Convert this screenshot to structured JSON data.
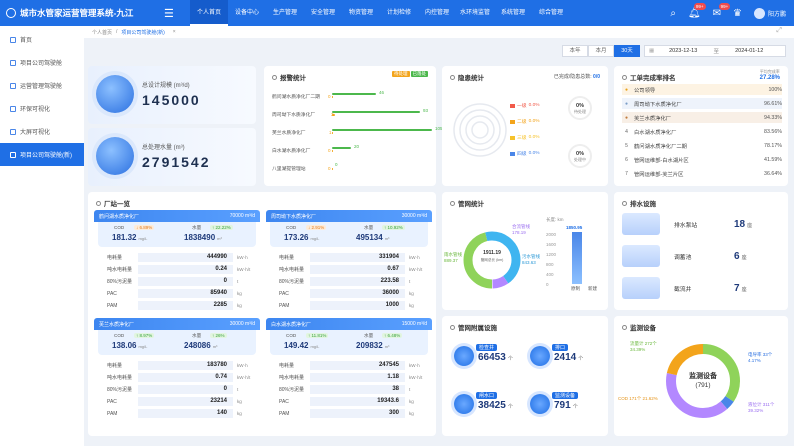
{
  "header": {
    "title": "城市水管家运营管理系统-九江",
    "nav": [
      "个人首页",
      "设备中心",
      "生产管理",
      "安全管理",
      "物资管理",
      "计划检修",
      "内控管理",
      "水环境监管",
      "系统管理",
      "综合管理"
    ],
    "badge1": "99+",
    "badge2": "99+",
    "user": "阳方鹏"
  },
  "sidebar": {
    "items": [
      "首页",
      "项目公司驾驶舱",
      "运营管理驾驶舱",
      "环保可视化",
      "大屏可视化",
      "项目公司驾驶舱(新)"
    ]
  },
  "breadcrumb": {
    "home": "个人首页",
    "sep": "/",
    "current": "项目公司驾驶舱(新)",
    "close": "×"
  },
  "filter": {
    "tabs": [
      "本年",
      "本月",
      "30天"
    ],
    "start": "2023-12-13",
    "to": "至",
    "end": "2024-01-12"
  },
  "kpi": [
    {
      "label": "总设计规模 (m³/d)",
      "value": "145000"
    },
    {
      "label": "总处理水量 (m³)",
      "value": "2791542"
    }
  ],
  "alarm": {
    "title": "报警统计",
    "tag1": "待处理",
    "tag2": "已落处",
    "rows": [
      {
        "name": "鹤问湖水质净化厂二期",
        "v1": "46",
        "v2": "0",
        "p1": 0.44,
        "p2": 0
      },
      {
        "name": "周司坳下水质净化厂",
        "v1": "93",
        "v2": "3",
        "p1": 0.88,
        "p2": 0.03
      },
      {
        "name": "芙兰水质净化厂",
        "v1": "105",
        "v2": "1",
        "p1": 1.0,
        "p2": 0.01
      },
      {
        "name": "白水湖水质净化厂",
        "v1": "20",
        "v2": "0",
        "p1": 0.19,
        "p2": 0
      },
      {
        "name": "八里湖提管理站",
        "v1": "0",
        "v2": "0",
        "p1": 0,
        "p2": 0
      }
    ]
  },
  "hazard": {
    "title": "隐患统计",
    "summary_label": "已完成/隐患总数:",
    "summary_value": "0/0",
    "levels": [
      {
        "name": "一级",
        "pct": "0.0%"
      },
      {
        "name": "二级",
        "pct": "0.0%"
      },
      {
        "name": "三级",
        "pct": "0.0%"
      },
      {
        "name": "四级",
        "pct": "0.0%"
      }
    ],
    "d1_pct": "0%",
    "d1_label": "待处理",
    "d2_pct": "0%",
    "d2_label": "处理中"
  },
  "ranking": {
    "title": "工单完成率排名",
    "avg_label": "平均完成率",
    "avg_value": "27.28%",
    "rows": [
      {
        "n": "",
        "name": "公司领导",
        "pct": "100%"
      },
      {
        "n": "",
        "name": "周司坳下水质净化厂",
        "pct": "96.61%"
      },
      {
        "n": "",
        "name": "芙兰水质净化厂",
        "pct": "94.33%"
      },
      {
        "n": "4",
        "name": "白水湖水质净化厂",
        "pct": "83.56%"
      },
      {
        "n": "5",
        "name": "鹤问湖水质净化厂二期",
        "pct": "78.17%"
      },
      {
        "n": "6",
        "name": "管网运维部-白水湖片区",
        "pct": "41.59%"
      },
      {
        "n": "7",
        "name": "管网运维部-芙兰片区",
        "pct": "36.64%"
      }
    ]
  },
  "plants": {
    "title": "厂站一览",
    "row_labels": [
      "电耗量",
      "吨水电耗量",
      "80%污泥量",
      "PAC",
      "PAM"
    ],
    "row_units": [
      "kW·h",
      "kW·h/t",
      "t",
      "kg",
      "kg"
    ],
    "items": [
      {
        "name": "鹤问湖水质净化厂",
        "cap": "70000 m³/d",
        "cod_label": "COD",
        "cod": "181.32",
        "cod_unit": "mg/L",
        "cod_tag": "↓ 6.89%",
        "water_label": "水量",
        "water": "1838490",
        "water_unit": "m³",
        "water_tag": "↑ 22.22%",
        "rows": [
          "444990",
          "0.24",
          "0",
          "85940",
          "2285"
        ]
      },
      {
        "name": "周司坳下水质净化厂",
        "cap": "30000 m³/d",
        "cod_label": "COD",
        "cod": "173.26",
        "cod_unit": "mg/L",
        "cod_tag": "↓ 2.91%",
        "water_label": "水量",
        "water": "495134",
        "water_unit": "m³",
        "water_tag": "↑ 10.92%",
        "rows": [
          "331904",
          "0.67",
          "223.58",
          "36000",
          "1000"
        ]
      },
      {
        "name": "芙兰水质净化厂",
        "cap": "30000 m³/d",
        "cod_label": "COD",
        "cod": "138.06",
        "cod_unit": "mg/L",
        "cod_tag": "↑ 8.97%",
        "water_label": "水量",
        "water": "248086",
        "water_unit": "m³",
        "water_tag": "↑ 26%",
        "rows": [
          "183780",
          "0.74",
          "0",
          "23214",
          "140"
        ]
      },
      {
        "name": "白水湖水质净化厂",
        "cap": "15000 m³/d",
        "cod_label": "COD",
        "cod": "149.42",
        "cod_unit": "mg/L",
        "cod_tag": "↑ 11.81%",
        "water_label": "水量",
        "water": "209832",
        "water_unit": "m³",
        "water_tag": "↑ 6.48%",
        "rows": [
          "247545",
          "1.18",
          "38",
          "19343.6",
          "300"
        ]
      }
    ]
  },
  "pipe": {
    "title": "管网统计",
    "center_value": "1911.19",
    "center_label": "管网总长 (km)",
    "left_label": "雨水管线 889.37",
    "right_label": "污水管线 843.63",
    "top_label": "合流管线 178.19",
    "unit": "长度: km",
    "bar_value": "1850.95",
    "bar_names": [
      "原制",
      "新建"
    ],
    "axis": [
      "2000",
      "1600",
      "1200",
      "800",
      "400",
      "0"
    ]
  },
  "drain": {
    "title": "排水设施",
    "items": [
      {
        "name": "排水泵站",
        "value": "18",
        "unit": "座"
      },
      {
        "name": "调蓄池",
        "value": "6",
        "unit": "座"
      },
      {
        "name": "截流井",
        "value": "7",
        "unit": "座"
      }
    ]
  },
  "facility": {
    "title": "管网附属设施",
    "items": [
      {
        "name": "检查井",
        "value": "66453",
        "unit": "个"
      },
      {
        "name": "排口",
        "value": "2414",
        "unit": "个"
      },
      {
        "name": "闸水口",
        "value": "38425",
        "unit": "个"
      },
      {
        "name": "监测设备",
        "value": "791",
        "unit": "个"
      }
    ]
  },
  "monitor": {
    "title": "监测设备",
    "center_label": "监测设备",
    "center_value": "(791)",
    "labels": [
      {
        "text": "流量计 272个 34.39%"
      },
      {
        "text": "电导率 33个 4.17%"
      },
      {
        "text": "COD 171个 21.62%"
      },
      {
        "text": "液位计 311个 39.32%"
      }
    ],
    "colors": [
      "#8fd35a",
      "#4a86e8",
      "#f3a41b",
      "#b388ff"
    ]
  }
}
